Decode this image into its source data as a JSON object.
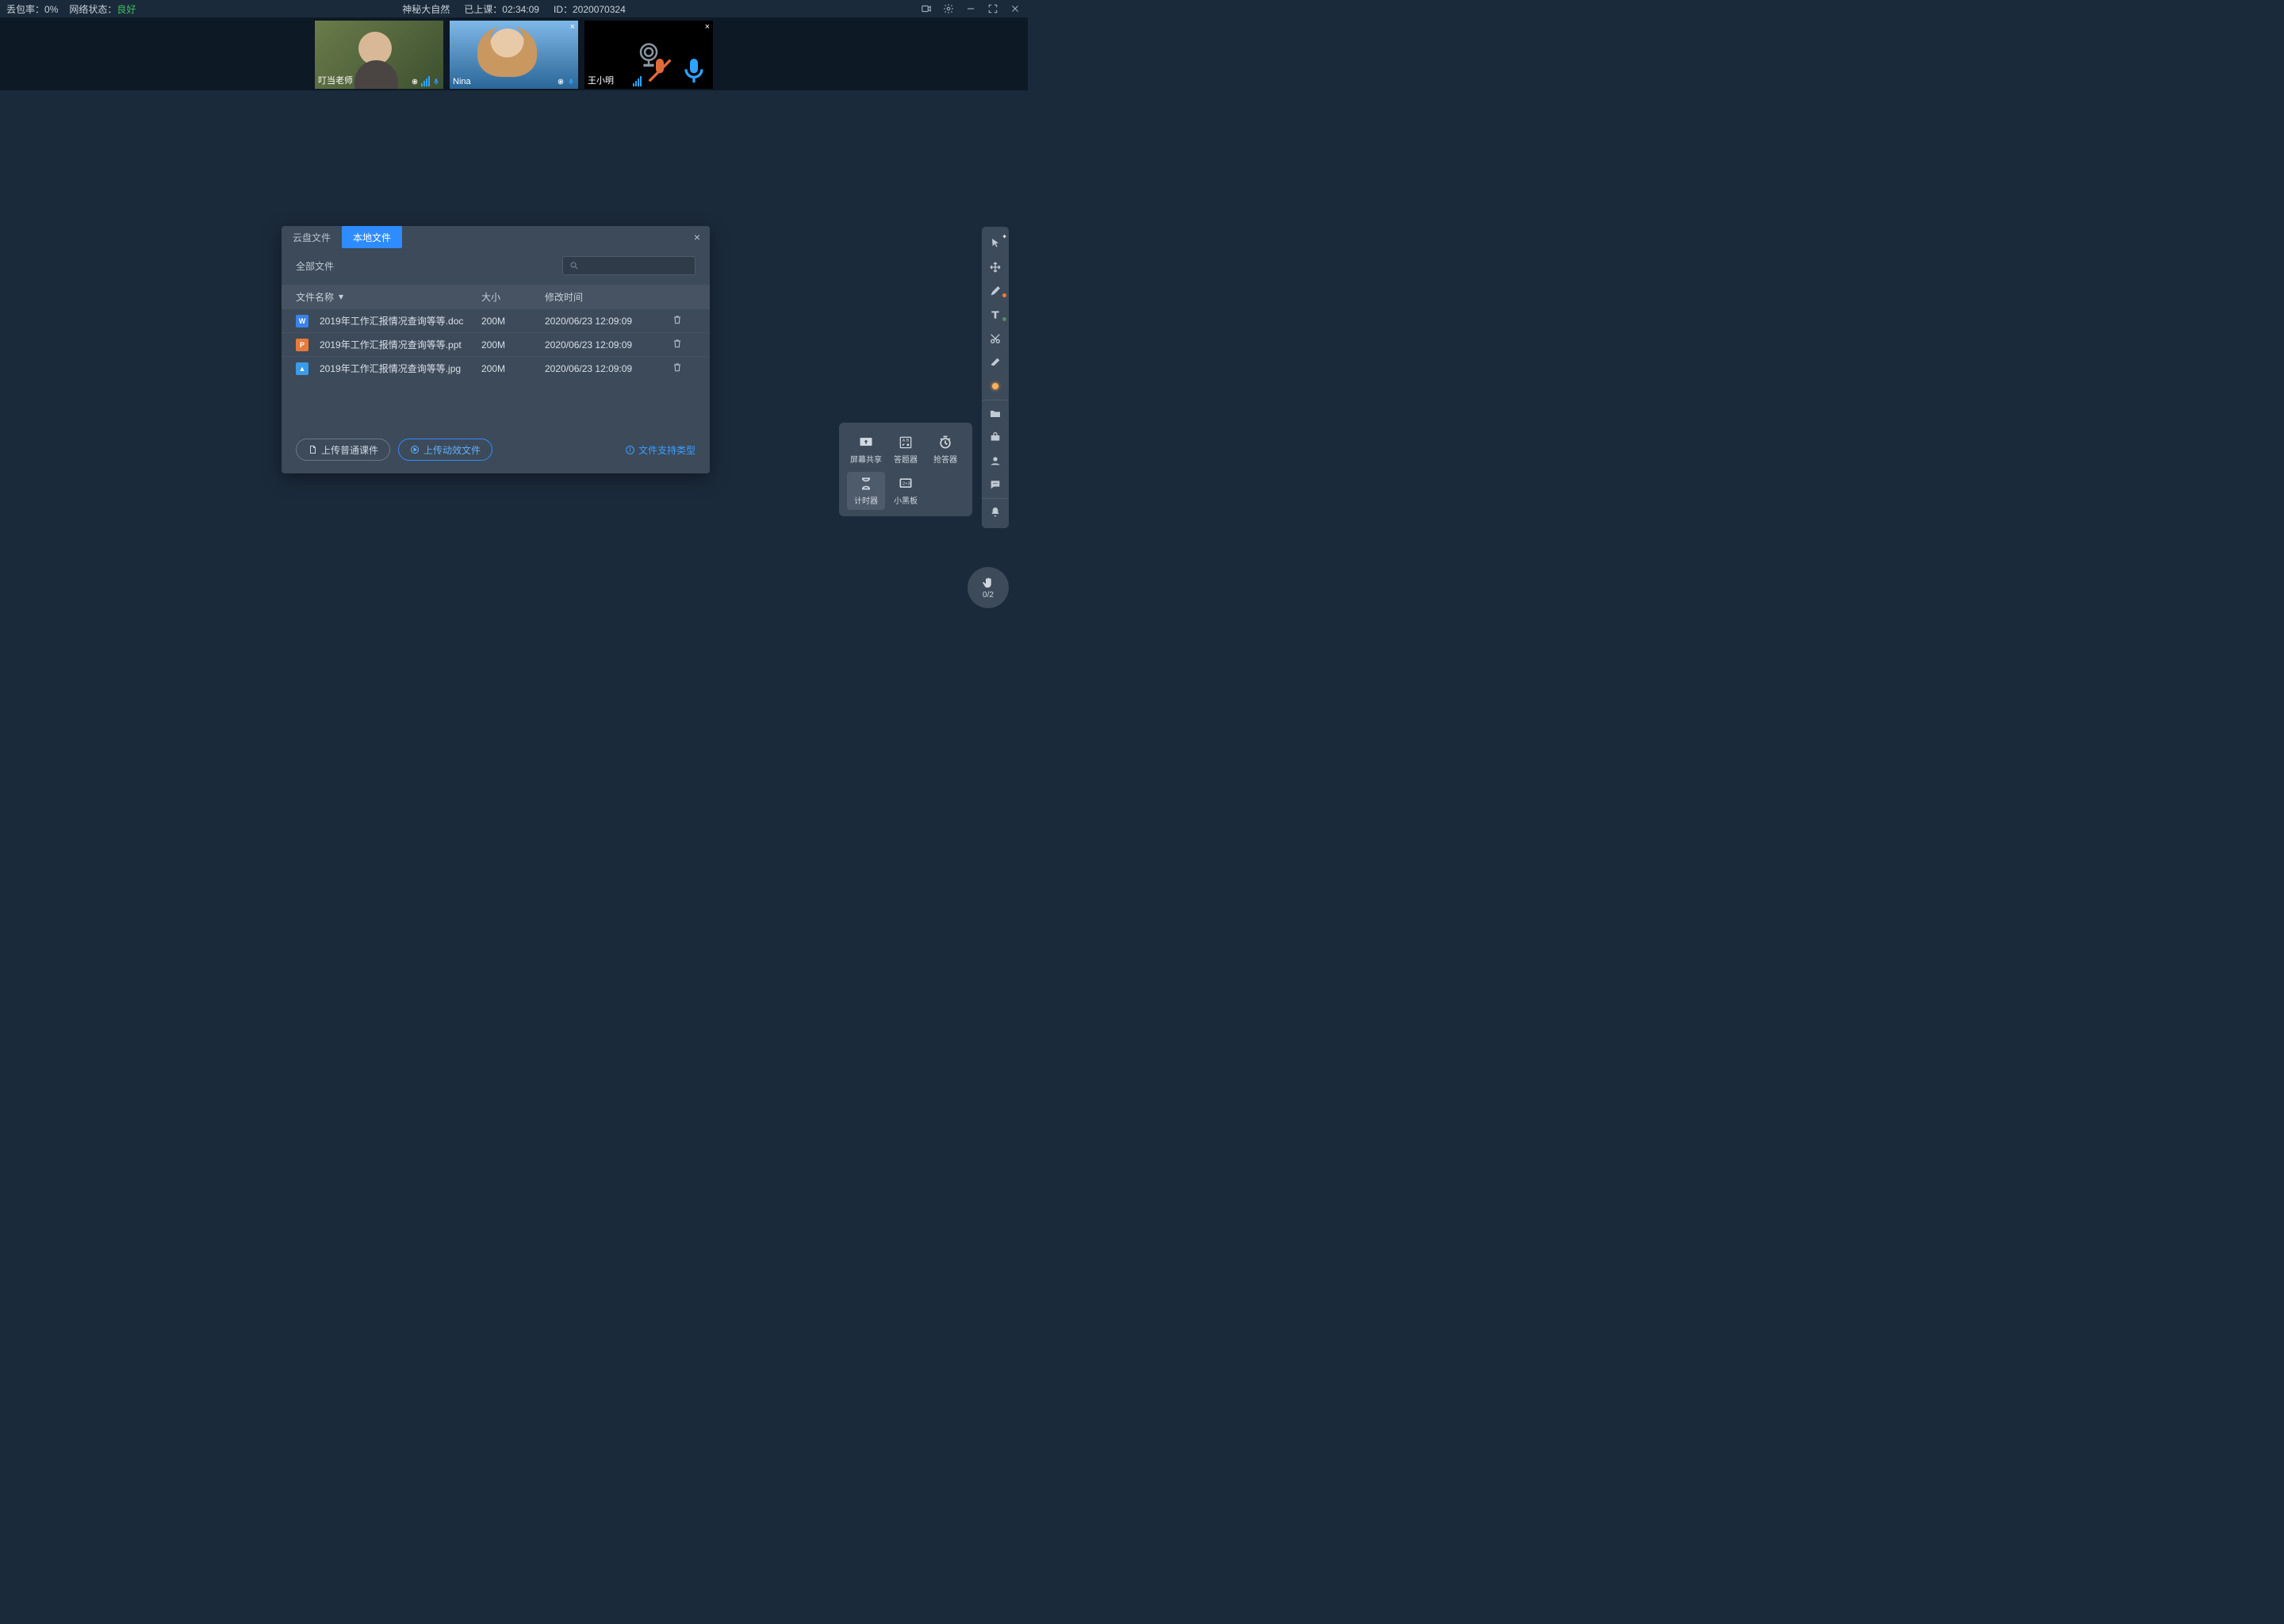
{
  "top": {
    "loss_label": "丢包率：",
    "loss_value": "0%",
    "net_label": "网络状态：",
    "net_value": "良好",
    "title": "神秘大自然",
    "elapsed_label": "已上课：",
    "elapsed_value": "02:34:09",
    "id_label": "ID：",
    "id_value": "2020070324"
  },
  "participants": [
    {
      "name": "叮当老师",
      "mic": "on",
      "camera": "on"
    },
    {
      "name": "Nina",
      "mic": "on",
      "camera": "on"
    },
    {
      "name": "王小明",
      "mic": "on",
      "mic_muted": true,
      "camera": "off"
    }
  ],
  "modal": {
    "tabs": [
      "云盘文件",
      "本地文件"
    ],
    "active_tab": 1,
    "filter_label": "全部文件",
    "columns": {
      "name": "文件名称",
      "size": "大小",
      "time": "修改时间"
    },
    "rows": [
      {
        "icon": "W",
        "name": "2019年工作汇报情况查询等等.doc",
        "size": "200M",
        "time": "2020/06/23 12:09:09"
      },
      {
        "icon": "P",
        "name": "2019年工作汇报情况查询等等.ppt",
        "size": "200M",
        "time": "2020/06/23 12:09:09"
      },
      {
        "icon": "I",
        "img": true,
        "name": "2019年工作汇报情况查询等等.jpg",
        "size": "200M",
        "time": "2020/06/23 12:09:09"
      }
    ],
    "btn_upload_normal": "上传普通课件",
    "btn_upload_anim": "上传动效文件",
    "hint": "文件支持类型"
  },
  "pop": {
    "items": [
      "屏幕共享",
      "答题器",
      "抢答器",
      "计时器",
      "小黑板"
    ],
    "selected": 3
  },
  "hand": {
    "count": "0/2"
  }
}
